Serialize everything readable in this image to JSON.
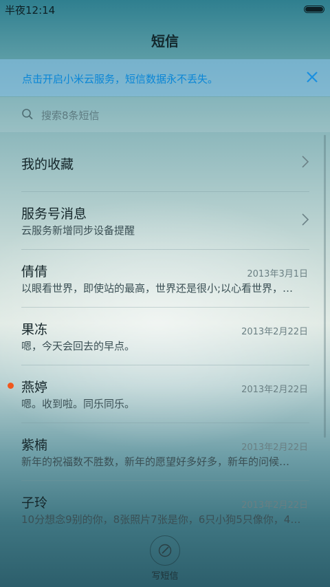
{
  "status_bar": {
    "time": "半夜12:14"
  },
  "header": {
    "title": "短信"
  },
  "banner": {
    "text": "点击开启小米云服务，短信数据永不丢失。"
  },
  "search": {
    "placeholder": "搜索8条短信"
  },
  "pinned": [
    {
      "name": "我的收藏",
      "subtitle": ""
    },
    {
      "name": "服务号消息",
      "subtitle": "云服务新增同步设备提醒"
    }
  ],
  "conversations": [
    {
      "name": "倩倩",
      "date": "2013年3月1日",
      "preview": "以眼看世界，即使站的最高，世界还是很小;以心看世界，…",
      "unread": false
    },
    {
      "name": "果冻",
      "date": "2013年2月22日",
      "preview": "嗯，今天会回去的早点。",
      "unread": false
    },
    {
      "name": "燕婷",
      "date": "2013年2月22日",
      "preview": "嗯。收到啦。同乐同乐。",
      "unread": true
    },
    {
      "name": "紫楠",
      "date": "2013年2月22日",
      "preview": "新年的祝福数不胜数，新年的愿望好多好多，新年的问候…",
      "unread": false
    },
    {
      "name": "子玲",
      "date": "2013年2月22日",
      "preview": "10分想念9别的你，8张照片7张是你，6只小狗5只像你，4…",
      "unread": false
    }
  ],
  "compose": {
    "label": "写短信"
  },
  "colors": {
    "accent": "#0b86d6",
    "unread_dot": "#f0581e"
  }
}
